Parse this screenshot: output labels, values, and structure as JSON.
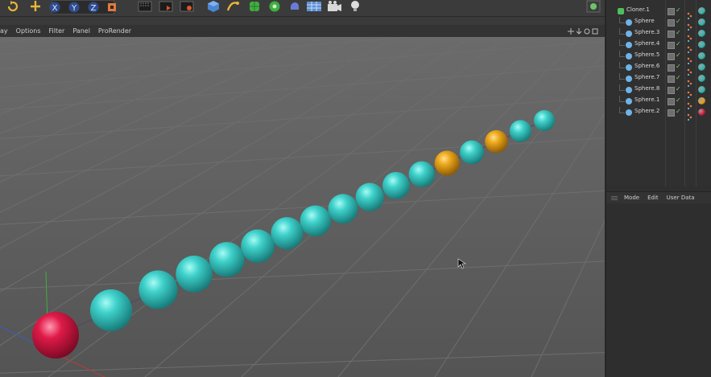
{
  "viewport": {
    "menu": [
      "ay",
      "Options",
      "Filter",
      "Panel",
      "ProRender"
    ]
  },
  "toolbar": {
    "icons": [
      {
        "name": "rotate-icon",
        "color": "#e6b53a"
      },
      {
        "name": "add-icon",
        "color": "#e6b53a"
      },
      {
        "name": "x-axis-icon",
        "color": "#6f8fd8"
      },
      {
        "name": "y-axis-icon",
        "color": "#6f8fd8"
      },
      {
        "name": "z-axis-icon",
        "color": "#6f8fd8"
      },
      {
        "name": "coordinate-system-icon",
        "color": "#e07a3a"
      },
      {
        "name": "render-view-icon",
        "color": "#222222"
      },
      {
        "name": "render-picture-viewer-icon",
        "color": "#222222"
      },
      {
        "name": "render-settings-icon",
        "color": "#222222"
      },
      {
        "name": "cube-icon",
        "color": "#4a86d4"
      },
      {
        "name": "spline-pen-icon",
        "color": "#e6b53a"
      },
      {
        "name": "subdivision-icon",
        "color": "#3fae3f"
      },
      {
        "name": "cloner-icon",
        "color": "#3fae3f"
      },
      {
        "name": "deformer-icon",
        "color": "#6a7bd6"
      },
      {
        "name": "floor-icon",
        "color": "#5d8fd6"
      },
      {
        "name": "camera-icon",
        "color": "#dddddd"
      },
      {
        "name": "light-icon",
        "color": "#dddddd"
      },
      {
        "name": "layout-icon",
        "color": "#6cc46a"
      }
    ]
  },
  "object_manager": {
    "objects": [
      {
        "name": "Cloner.1",
        "type": "cloner",
        "tag_color": "#2fb8b0"
      },
      {
        "name": "Sphere",
        "type": "sphere",
        "tag_color": "#2fb8b0"
      },
      {
        "name": "Sphere.3",
        "type": "sphere",
        "tag_color": "#2fb8b0"
      },
      {
        "name": "Sphere.4",
        "type": "sphere",
        "tag_color": "#2fb8b0"
      },
      {
        "name": "Sphere.5",
        "type": "sphere",
        "tag_color": "#2fb8b0"
      },
      {
        "name": "Sphere.6",
        "type": "sphere",
        "tag_color": "#2fb8b0"
      },
      {
        "name": "Sphere.7",
        "type": "sphere",
        "tag_color": "#2fb8b0"
      },
      {
        "name": "Sphere.8",
        "type": "sphere",
        "tag_color": "#2fb8b0"
      },
      {
        "name": "Sphere.1",
        "type": "sphere",
        "tag_color": "#e8a21c"
      },
      {
        "name": "Sphere.2",
        "type": "sphere",
        "tag_color": "#d2193e"
      }
    ]
  },
  "attribute_manager": {
    "menu": [
      "Mode",
      "Edit",
      "User Data"
    ]
  },
  "scene": {
    "colors": {
      "cyan": "#2fc4c0",
      "orange": "#e9a614",
      "red": "#e01a48",
      "grid": "#6e6e6e",
      "floor": "#575757"
    },
    "spheres": [
      {
        "color": "cyan"
      },
      {
        "color": "cyan"
      },
      {
        "color": "cyan"
      },
      {
        "color": "cyan"
      },
      {
        "color": "cyan"
      },
      {
        "color": "cyan"
      },
      {
        "color": "cyan"
      },
      {
        "color": "cyan"
      },
      {
        "color": "cyan"
      },
      {
        "color": "cyan"
      },
      {
        "color": "cyan"
      },
      {
        "color": "orange"
      },
      {
        "color": "cyan"
      },
      {
        "color": "orange"
      },
      {
        "color": "cyan"
      },
      {
        "color": "cyan"
      }
    ],
    "origin_sphere": {
      "color": "red"
    }
  }
}
